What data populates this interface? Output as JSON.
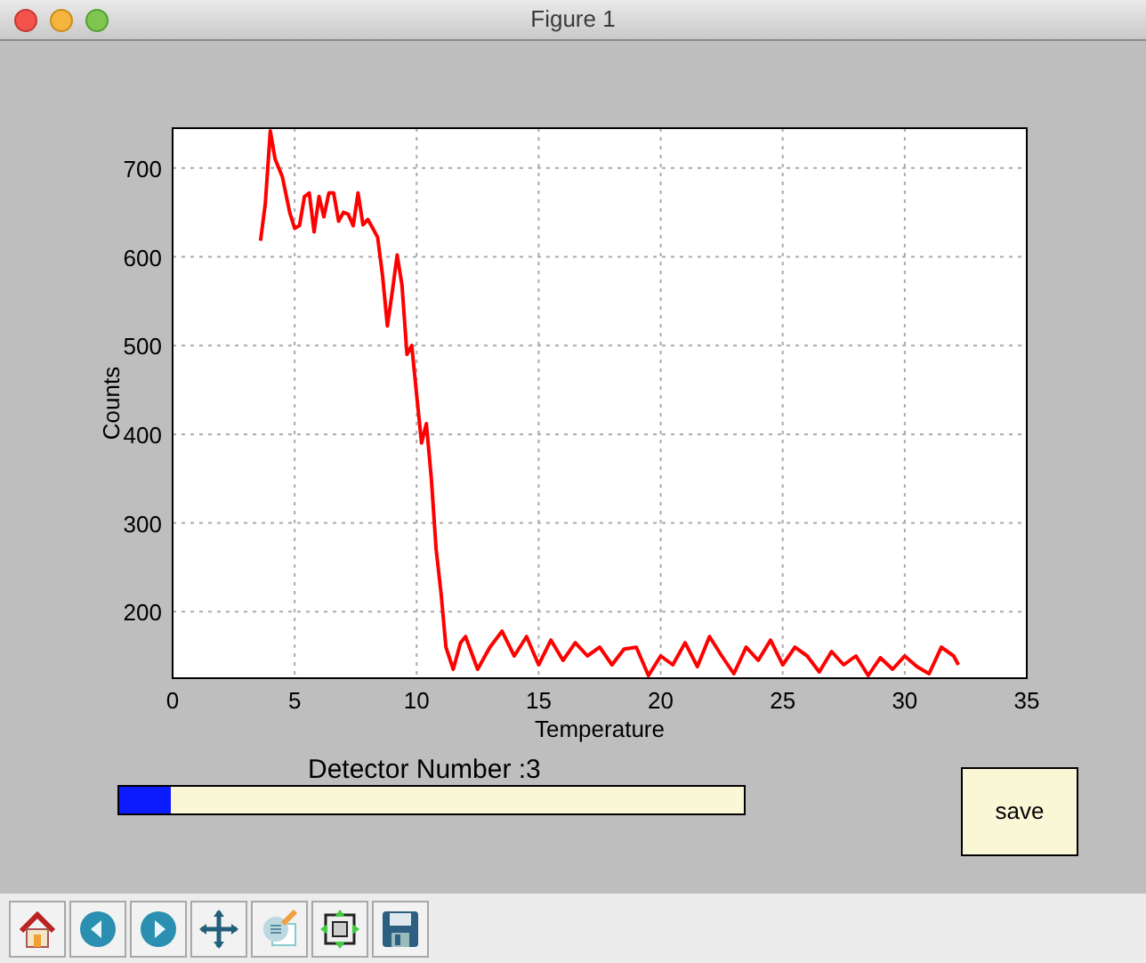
{
  "window": {
    "title": "Figure 1"
  },
  "figure": {
    "chart_data": {
      "type": "line",
      "grid": true,
      "xlabel": "Temperature",
      "ylabel": "Counts",
      "xlim": [
        0,
        35
      ],
      "ylim": [
        125,
        745
      ],
      "xticks": [
        0,
        5,
        10,
        15,
        20,
        25,
        30,
        35
      ],
      "yticks": [
        200,
        300,
        400,
        500,
        600,
        700
      ],
      "x": [
        3.6,
        3.8,
        4.0,
        4.2,
        4.5,
        4.8,
        5.0,
        5.2,
        5.4,
        5.6,
        5.8,
        6.0,
        6.2,
        6.4,
        6.6,
        6.8,
        7.0,
        7.2,
        7.4,
        7.6,
        7.8,
        8.0,
        8.2,
        8.4,
        8.6,
        8.8,
        9.0,
        9.2,
        9.4,
        9.6,
        9.8,
        10.0,
        10.2,
        10.4,
        10.6,
        10.8,
        11.0,
        11.2,
        11.5,
        11.8,
        12.0,
        12.5,
        13.0,
        13.5,
        14.0,
        14.5,
        15.0,
        15.5,
        16.0,
        16.5,
        17.0,
        17.5,
        18.0,
        18.5,
        19.0,
        19.5,
        20.0,
        20.5,
        21.0,
        21.5,
        22.0,
        22.5,
        23.0,
        23.5,
        24.0,
        24.5,
        25.0,
        25.5,
        26.0,
        26.5,
        27.0,
        27.5,
        28.0,
        28.5,
        29.0,
        29.5,
        30.0,
        30.5,
        31.0,
        31.5,
        32.0,
        32.2
      ],
      "series": [
        {
          "color": "#ff0000",
          "values": [
            618,
            660,
            742,
            710,
            690,
            650,
            632,
            635,
            668,
            672,
            628,
            668,
            645,
            672,
            672,
            640,
            650,
            648,
            635,
            672,
            636,
            642,
            632,
            622,
            580,
            522,
            560,
            602,
            568,
            490,
            500,
            445,
            390,
            412,
            350,
            270,
            220,
            160,
            135,
            165,
            172,
            135,
            160,
            178,
            150,
            172,
            140,
            168,
            145,
            165,
            150,
            160,
            140,
            158,
            160,
            128,
            150,
            140,
            165,
            138,
            172,
            150,
            130,
            160,
            145,
            168,
            140,
            160,
            150,
            132,
            155,
            140,
            150,
            128,
            148,
            135,
            150,
            138,
            130,
            160,
            150,
            140
          ]
        }
      ]
    }
  },
  "detector": {
    "label": "Detector Number :3",
    "level": 0.083
  },
  "save_button": {
    "label": "save"
  },
  "toolbar": [
    {
      "kind": "home"
    },
    {
      "kind": "back"
    },
    {
      "kind": "forward"
    },
    {
      "kind": "pan"
    },
    {
      "kind": "edit"
    },
    {
      "kind": "fit"
    },
    {
      "kind": "save"
    }
  ]
}
